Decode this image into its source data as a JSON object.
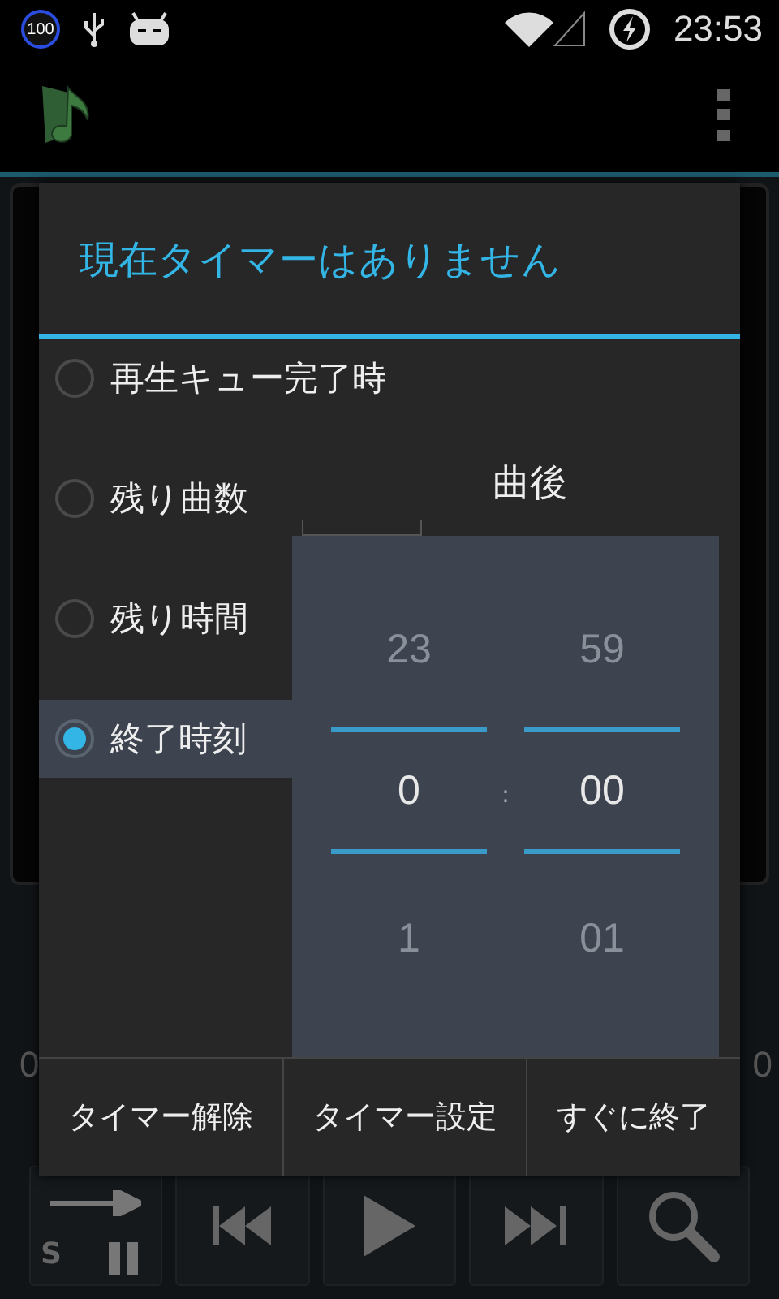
{
  "status_bar": {
    "battery": "100",
    "time": "23:53"
  },
  "dialog": {
    "title": "現在タイマーはありません",
    "options": [
      {
        "label": "再生キュー完了時",
        "selected": false
      },
      {
        "label": "残り曲数",
        "selected": false
      },
      {
        "label": "残り時間",
        "selected": false
      },
      {
        "label": "終了時刻",
        "selected": true
      }
    ],
    "song_count_suffix": "曲後",
    "time_picker": {
      "hours": {
        "prev": "23",
        "current": "0",
        "next": "1"
      },
      "separator": ":",
      "minutes": {
        "prev": "59",
        "current": "00",
        "next": "01"
      }
    },
    "buttons": [
      "タイマー解除",
      "タイマー設定",
      "すぐに終了"
    ]
  },
  "player": {
    "elapsed": "0",
    "total": "0",
    "shuffle_label": "S"
  }
}
